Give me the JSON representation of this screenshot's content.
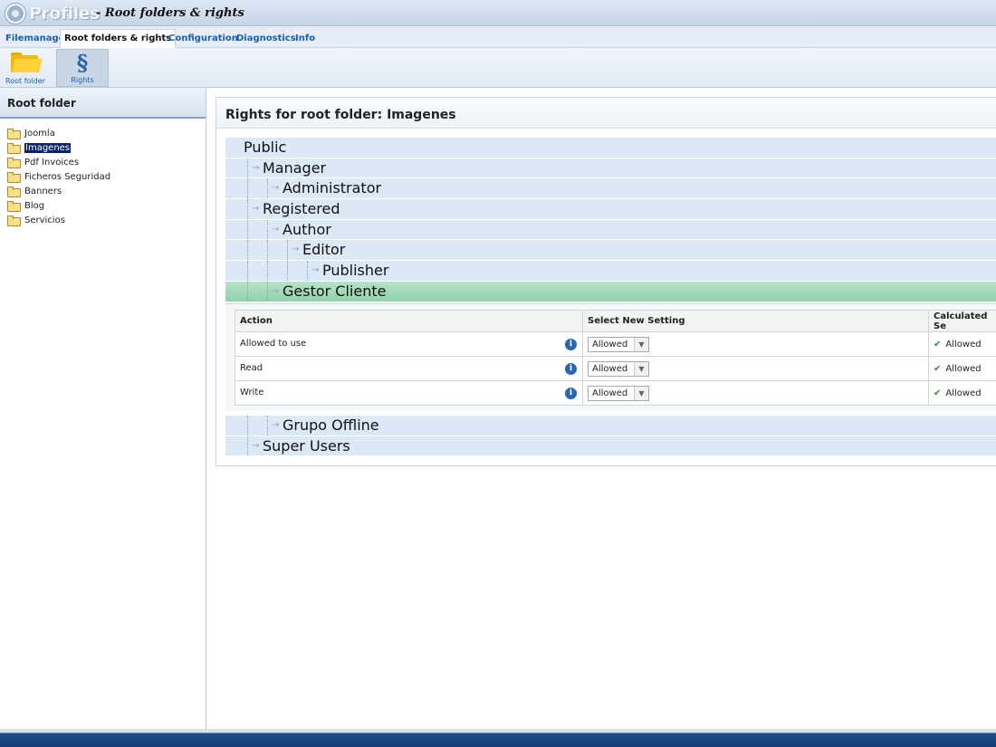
{
  "header": {
    "logo_text": "Profiles",
    "page_title": "- Root folders & rights"
  },
  "tabs": [
    {
      "label": "Filemanager"
    },
    {
      "label": "Root folders & rights"
    },
    {
      "label": "Configuration"
    },
    {
      "label": "Diagnostics"
    },
    {
      "label": "Info"
    }
  ],
  "toolbar": {
    "root_folder_label": "Root folder",
    "rights_label": "Rights",
    "rights_icon": "§"
  },
  "left_panel": {
    "title": "Root folder",
    "folders": [
      {
        "name": "Joomla"
      },
      {
        "name": "Imagenes"
      },
      {
        "name": "Pdf Invoices"
      },
      {
        "name": "Ficheros Seguridad"
      },
      {
        "name": "Banners"
      },
      {
        "name": "Blog"
      },
      {
        "name": "Servicios"
      }
    ],
    "selected": "Imagenes"
  },
  "right_panel": {
    "title": "Rights for root folder: Imagenes",
    "groups": [
      {
        "name": "Public"
      },
      {
        "name": "Manager"
      },
      {
        "name": "Administrator"
      },
      {
        "name": "Registered"
      },
      {
        "name": "Author"
      },
      {
        "name": "Editor"
      },
      {
        "name": "Publisher"
      },
      {
        "name": "Gestor Cliente"
      }
    ],
    "groups_after": [
      {
        "name": "Grupo Offline"
      },
      {
        "name": "Super Users"
      }
    ],
    "selected_group": "Gestor Cliente",
    "table": {
      "headers": {
        "action": "Action",
        "select": "Select New Setting",
        "calculated": "Calculated Se"
      },
      "rows": [
        {
          "action": "Allowed to use",
          "setting": "Allowed",
          "calculated": "Allowed"
        },
        {
          "action": "Read",
          "setting": "Allowed",
          "calculated": "Allowed"
        },
        {
          "action": "Write",
          "setting": "Allowed",
          "calculated": "Allowed"
        }
      ]
    }
  },
  "icons": {
    "info": "i",
    "check": "✔",
    "dropdown": "▼",
    "arrow": "→"
  },
  "colors": {
    "selected_group_bg": "#9fd8b6",
    "group_row_bg": "#dbe8f6",
    "link_blue": "#1d5fa8",
    "selection_navy": "#0a246a"
  }
}
